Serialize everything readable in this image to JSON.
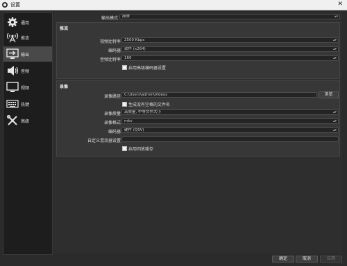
{
  "window": {
    "title": "设置"
  },
  "sidebar": {
    "items": [
      {
        "label": "通用",
        "icon": "gear-icon"
      },
      {
        "label": "推流",
        "icon": "broadcast-icon"
      },
      {
        "label": "输出",
        "icon": "output-icon"
      },
      {
        "label": "音频",
        "icon": "speaker-icon"
      },
      {
        "label": "视频",
        "icon": "monitor-icon"
      },
      {
        "label": "热键",
        "icon": "keyboard-icon"
      },
      {
        "label": "高级",
        "icon": "tools-icon"
      }
    ],
    "active_index": 2
  },
  "output_mode": {
    "label": "输出模式",
    "value": "简单"
  },
  "streaming": {
    "title": "推流",
    "video_bitrate": {
      "label": "视频比特率",
      "value": "2500 Kbps"
    },
    "encoder": {
      "label": "编码器",
      "value": "软件 (x264)"
    },
    "audio_bitrate": {
      "label": "音频比特率",
      "value": "160"
    },
    "advanced_encoder": {
      "label": "启用高级编码器设置",
      "checked": false
    }
  },
  "recording": {
    "title": "录像",
    "path": {
      "label": "录像路径",
      "value": "C:\\Users\\admin\\Videos",
      "browse": "浏览"
    },
    "no_space": {
      "label": "生成没有空格的文件名",
      "checked": false
    },
    "quality": {
      "label": "录像质量",
      "value": "高质量, 中等文件大小"
    },
    "format": {
      "label": "录像格式",
      "value": "mkv"
    },
    "encoder": {
      "label": "编码器",
      "value": "硬件 (QSV)"
    },
    "muxer": {
      "label": "自定义混流器设置",
      "value": ""
    },
    "replay_buffer": {
      "label": "启用回放缓存",
      "checked": false
    }
  },
  "buttons": {
    "ok": "确定",
    "cancel": "取消",
    "apply": "应用"
  },
  "colors": {
    "background": "#2b2b2b",
    "sidebar": "#1d1d1d",
    "active": "#494949",
    "field": "#242424"
  }
}
